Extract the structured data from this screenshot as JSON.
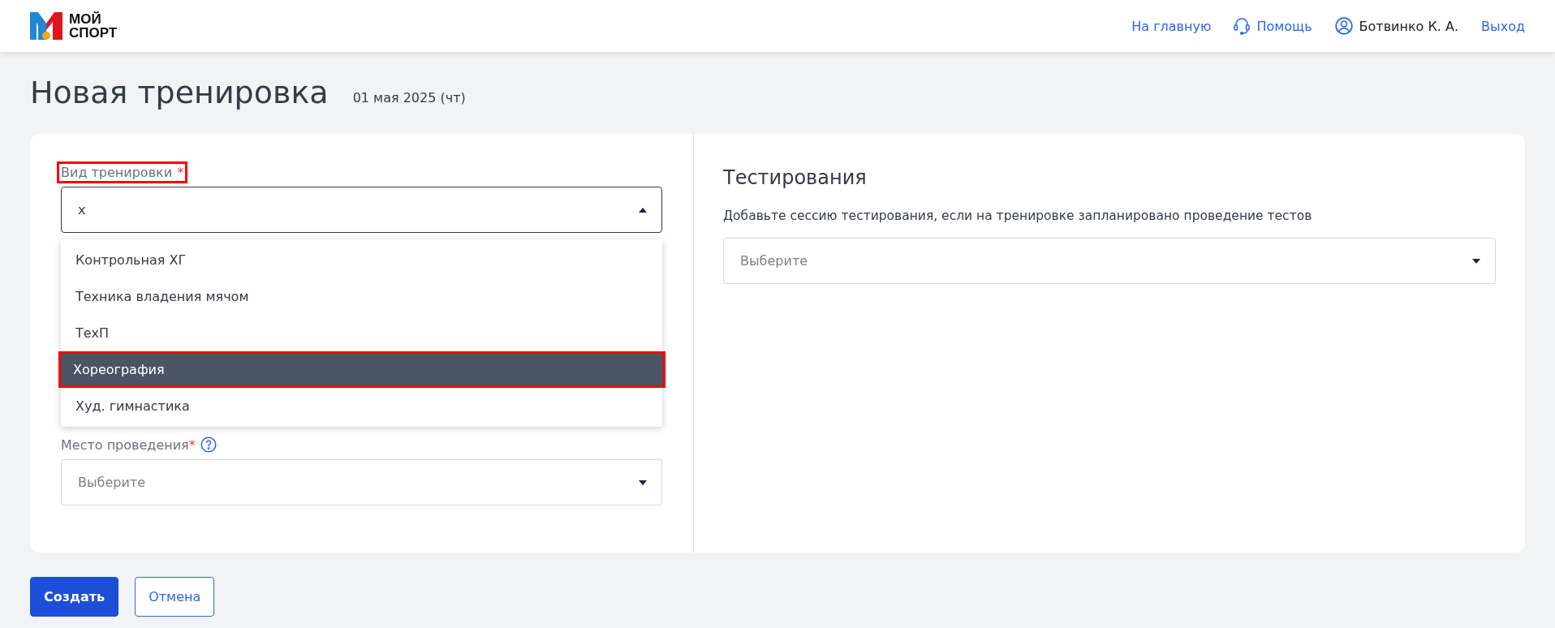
{
  "header": {
    "logo": {
      "line_1": "МОЙ",
      "line_2": "СПОРТ"
    },
    "nav": [
      {
        "kind": "link",
        "label": "На главную"
      },
      {
        "kind": "help",
        "label": "Помощь"
      },
      {
        "kind": "user",
        "label": "Ботвинко К. А."
      },
      {
        "kind": "link",
        "label": "Выход"
      }
    ]
  },
  "page": {
    "title": "Новая тренировка",
    "date": "01 мая 2025 (чт)"
  },
  "training_type": {
    "label": "Вид тренировки",
    "required_mark": "*",
    "annotated": true,
    "value": "х",
    "expanded": true,
    "options": [
      {
        "label": "Контрольная ХГ",
        "selected": false,
        "annotated": false
      },
      {
        "label": "Техника владения мячом",
        "selected": false,
        "annotated": false
      },
      {
        "label": "ТехП",
        "selected": false,
        "annotated": false
      },
      {
        "label": "Хореография",
        "selected": true,
        "annotated": true
      },
      {
        "label": "Худ. гимнастика",
        "selected": false,
        "annotated": false
      }
    ]
  },
  "venue": {
    "label": "Место проведения",
    "required_mark": "*",
    "placeholder": "Выберите",
    "expanded": false
  },
  "testing": {
    "title": "Тестирования",
    "description": "Добавьте сессию тестирования, если на тренировке запланировано проведение тестов",
    "placeholder": "Выберите",
    "expanded": false
  },
  "buttons": [
    {
      "kind": "primary",
      "label": "Создать"
    },
    {
      "kind": "secondary",
      "label": "Отмена"
    }
  ]
}
